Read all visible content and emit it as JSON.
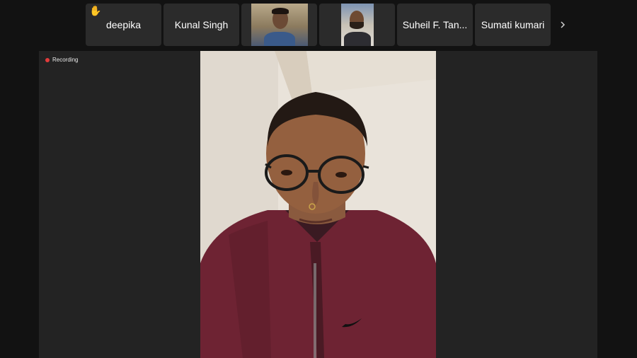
{
  "participants": [
    {
      "name": "deepika",
      "hand_raised": true,
      "icon": "raised-hand-icon"
    },
    {
      "name": "Kunal Singh",
      "hand_raised": false
    },
    {
      "name": "",
      "video": true
    },
    {
      "name": "",
      "video": true
    },
    {
      "name": "Suheil F. Tan...",
      "hand_raised": false
    },
    {
      "name": "Sumati kumari",
      "hand_raised": false
    }
  ],
  "recording": {
    "label": "Recording",
    "dot_color": "#e23b3b"
  },
  "nav": {
    "next_icon": "chevron-right-icon"
  },
  "colors": {
    "background": "#121212",
    "tile": "#2b2b2b",
    "stage": "#232323"
  }
}
